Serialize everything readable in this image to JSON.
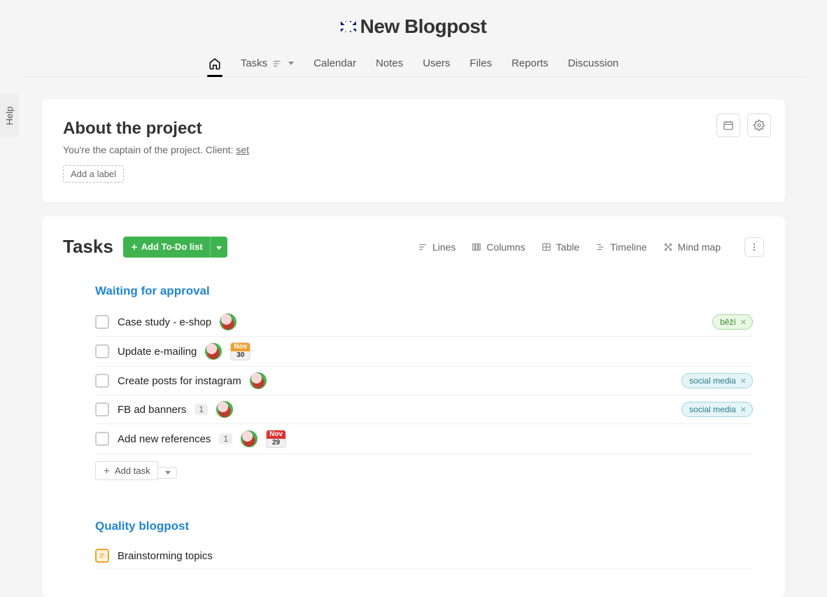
{
  "help_label": "Help",
  "page_title": "New Blogpost",
  "tabs": {
    "tasks": "Tasks",
    "calendar": "Calendar",
    "notes": "Notes",
    "users": "Users",
    "files": "Files",
    "reports": "Reports",
    "discussion": "Discussion"
  },
  "about": {
    "heading": "About the project",
    "desc_prefix": "You're the captain of the project. Client: ",
    "client_link": "set",
    "add_label": "Add a label"
  },
  "tasks_section": {
    "heading": "Tasks",
    "add_button": "Add To-Do list",
    "views": {
      "lines": "Lines",
      "columns": "Columns",
      "table": "Table",
      "timeline": "Timeline",
      "mindmap": "Mind map"
    },
    "lists": [
      {
        "title": "Waiting for approval",
        "tasks": [
          {
            "name": "Case study - e-shop",
            "avatar": true,
            "label": {
              "text": "běží",
              "style": "green"
            }
          },
          {
            "name": "Update e-mailing",
            "avatar": true,
            "date": {
              "month": "Nov",
              "day": "30",
              "style": "orange"
            }
          },
          {
            "name": "Create posts for instagram",
            "avatar": true,
            "label": {
              "text": "social media",
              "style": "blue"
            }
          },
          {
            "name": "FB ad banners",
            "count": "1",
            "avatar": true,
            "label": {
              "text": "social media",
              "style": "blue"
            }
          },
          {
            "name": "Add new references",
            "count": "1",
            "avatar": true,
            "date": {
              "month": "Nov",
              "day": "29",
              "style": "red"
            }
          }
        ],
        "add_task": "Add task"
      },
      {
        "title": "Quality blogpost",
        "tasks": [
          {
            "name": "Brainstorming topics",
            "note": true
          }
        ]
      }
    ]
  }
}
